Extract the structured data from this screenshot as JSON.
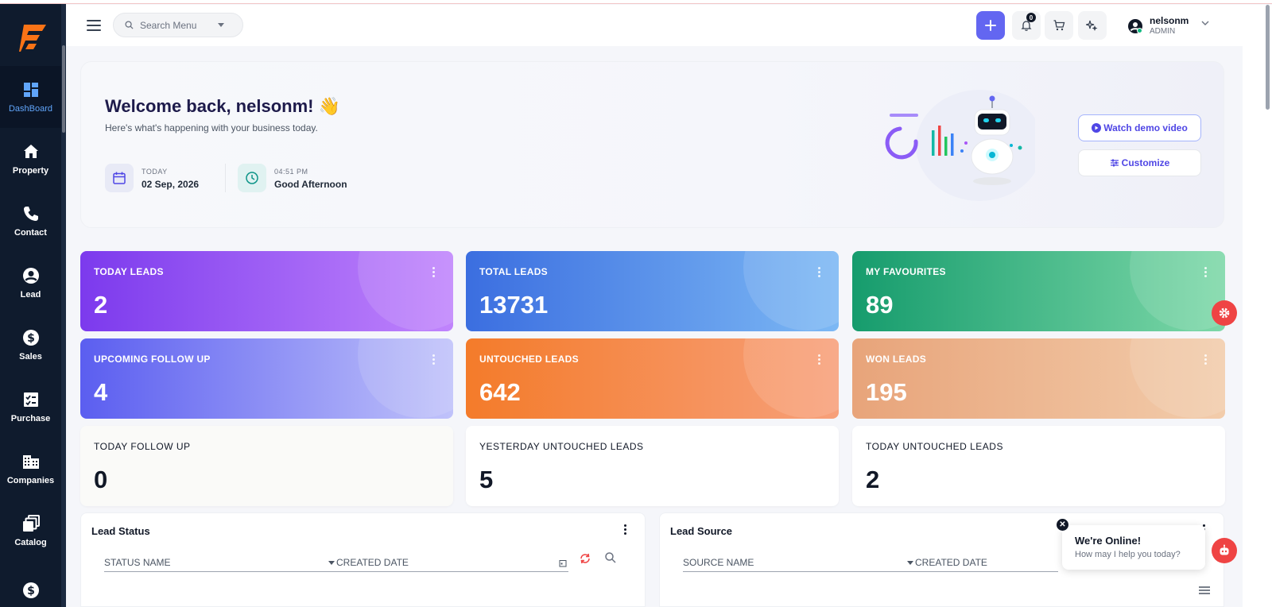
{
  "sidebar": {
    "items": [
      {
        "label": "DashBoard",
        "icon": "dashboard-icon"
      },
      {
        "label": "Property",
        "icon": "home-icon"
      },
      {
        "label": "Contact",
        "icon": "phone-icon"
      },
      {
        "label": "Lead",
        "icon": "user-circle-icon"
      },
      {
        "label": "Sales",
        "icon": "dollar-icon"
      },
      {
        "label": "Purchase",
        "icon": "checklist-icon"
      },
      {
        "label": "Companies",
        "icon": "building-icon"
      },
      {
        "label": "Catalog",
        "icon": "catalog-icon"
      },
      {
        "label": "",
        "icon": "dollar-icon"
      }
    ]
  },
  "topbar": {
    "search_placeholder": "Search Menu",
    "notification_count": "0",
    "user_name": "nelsonm",
    "user_role": "ADMIN"
  },
  "welcome": {
    "title": "Welcome back, nelsonm! 👋",
    "subtitle": "Here's what's happening with your business today.",
    "date_label": "TODAY",
    "date_value": "02 Sep, 2026",
    "time_label": "04:51 PM",
    "greeting": "Good Afternoon",
    "demo_button": "Watch demo video",
    "customize_button": "Customize"
  },
  "stats": [
    {
      "title": "TODAY LEADS",
      "value": "2"
    },
    {
      "title": "TOTAL LEADS",
      "value": "13731"
    },
    {
      "title": "MY FAVOURITES",
      "value": "89"
    },
    {
      "title": "UPCOMING FOLLOW UP",
      "value": "4"
    },
    {
      "title": "UNTOUCHED LEADS",
      "value": "642"
    },
    {
      "title": "WON LEADS",
      "value": "195"
    },
    {
      "title": "TODAY FOLLOW UP",
      "value": "0"
    },
    {
      "title": "YESTERDAY UNTOUCHED LEADS",
      "value": "5"
    },
    {
      "title": "TODAY UNTOUCHED LEADS",
      "value": "2"
    }
  ],
  "lead_status": {
    "title": "Lead Status",
    "status_field": "STATUS NAME",
    "date_field": "CREATED DATE"
  },
  "lead_source": {
    "title": "Lead Source",
    "source_field": "SOURCE NAME",
    "date_field": "CREATED DATE"
  },
  "chat": {
    "title": "We're Online!",
    "message": "How may I help you today?"
  },
  "colors": {
    "sidebar_bg": "#0f1b2d",
    "accent": "#6366f1",
    "fab": "#ef4444"
  }
}
